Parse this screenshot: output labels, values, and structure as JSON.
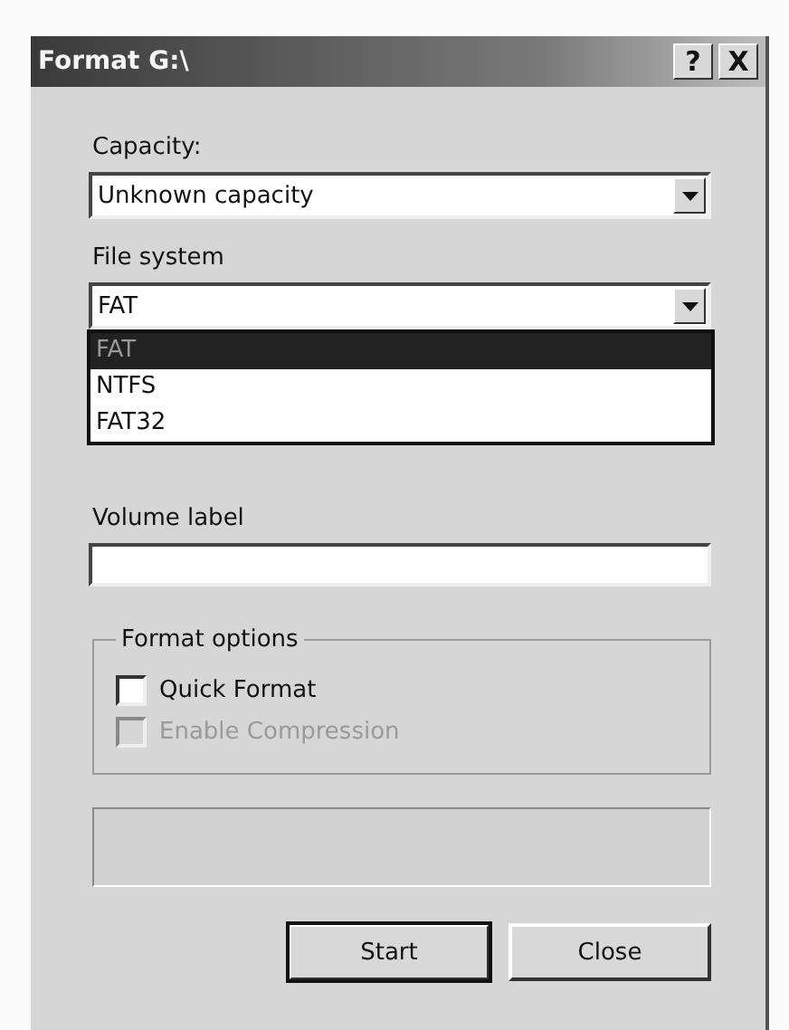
{
  "window": {
    "title": "Format G:\\",
    "help_button": "?",
    "close_button": "X"
  },
  "capacity": {
    "label": "Capacity:",
    "value": "Unknown capacity"
  },
  "file_system": {
    "label": "File system",
    "value": "FAT",
    "expanded": true,
    "options": [
      {
        "label": "FAT",
        "selected": true
      },
      {
        "label": "NTFS",
        "selected": false
      },
      {
        "label": "FAT32",
        "selected": false
      }
    ]
  },
  "volume_label": {
    "label": "Volume label"
  },
  "format_options": {
    "title": "Format options",
    "options": [
      {
        "label": "Quick Format",
        "checked": false,
        "disabled": false
      },
      {
        "label": "Enable Compression",
        "checked": false,
        "disabled": true
      }
    ]
  },
  "buttons": [
    {
      "label": "Start",
      "default": true
    },
    {
      "label": "Close",
      "default": false
    }
  ]
}
